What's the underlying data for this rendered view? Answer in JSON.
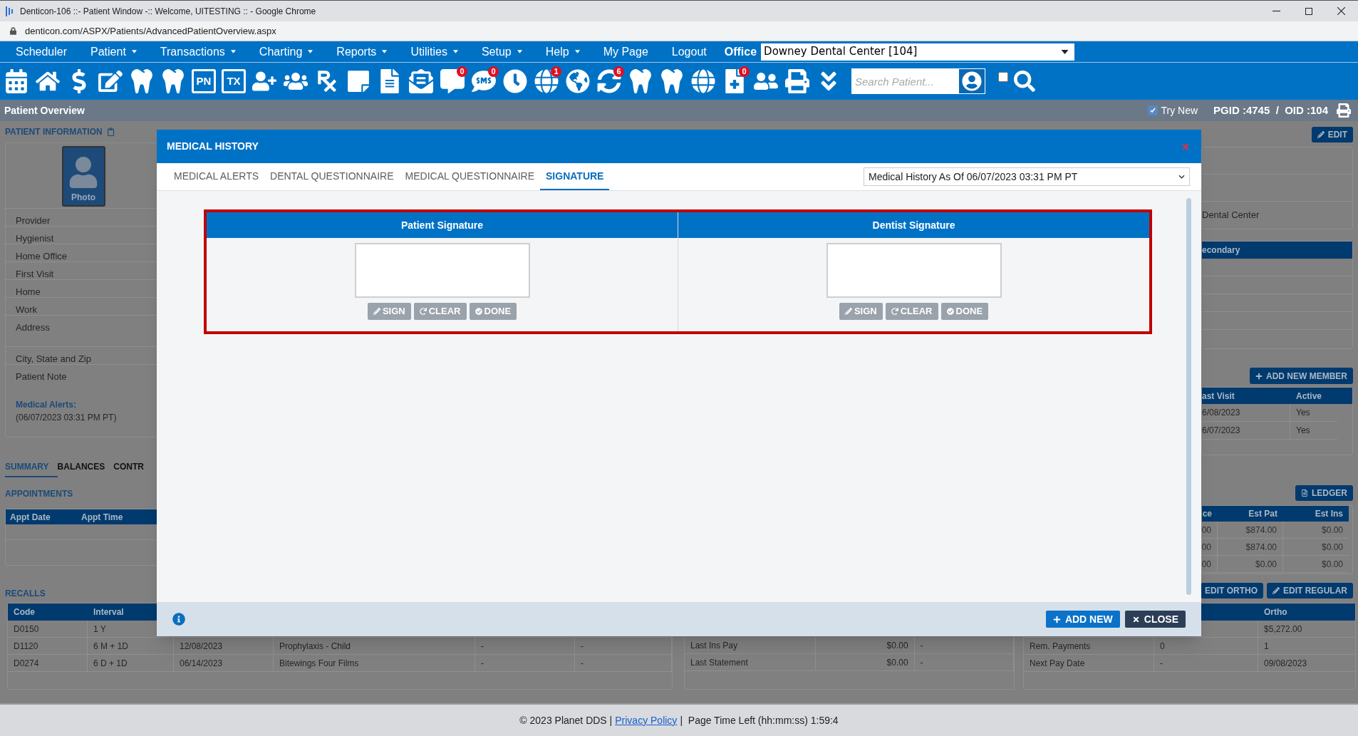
{
  "browser": {
    "title": "Denticon-106 ::- Patient Window -:: Welcome, UITESTING :: - Google Chrome",
    "url": "denticon.com/ASPX/Patients/AdvancedPatientOverview.aspx"
  },
  "menu": [
    {
      "label": "Scheduler",
      "dropdown": false
    },
    {
      "label": "Patient",
      "dropdown": true
    },
    {
      "label": "Transactions",
      "dropdown": true
    },
    {
      "label": "Charting",
      "dropdown": true
    },
    {
      "label": "Reports",
      "dropdown": true
    },
    {
      "label": "Utilities",
      "dropdown": true
    },
    {
      "label": "Setup",
      "dropdown": true
    },
    {
      "label": "Help",
      "dropdown": true
    },
    {
      "label": "My Page",
      "dropdown": false
    },
    {
      "label": "Logout",
      "dropdown": false
    }
  ],
  "office": {
    "label": "Office",
    "value": "Downey Dental Center [104]"
  },
  "toolbar": [
    {
      "kind": "icon"
    },
    {
      "kind": "icon"
    },
    {
      "kind": "icon"
    },
    {
      "kind": "icon"
    },
    {
      "kind": "icon"
    },
    {
      "kind": "icon"
    },
    {
      "kind": "text",
      "label": "PN"
    },
    {
      "kind": "text",
      "label": "TX"
    },
    {
      "kind": "icon"
    },
    {
      "kind": "icon"
    },
    {
      "kind": "icon"
    },
    {
      "kind": "icon"
    },
    {
      "kind": "icon"
    },
    {
      "kind": "icon"
    },
    {
      "kind": "icon",
      "badge": "0"
    },
    {
      "kind": "icon",
      "badge": "0"
    },
    {
      "kind": "icon"
    },
    {
      "kind": "icon",
      "badge": "1"
    },
    {
      "kind": "icon"
    },
    {
      "kind": "icon",
      "badge": "6"
    },
    {
      "kind": "icon"
    },
    {
      "kind": "icon"
    },
    {
      "kind": "icon"
    },
    {
      "kind": "icon",
      "badge": "0"
    },
    {
      "kind": "icon"
    },
    {
      "kind": "icon"
    },
    {
      "kind": "icon"
    }
  ],
  "search": {
    "placeholder": "Search Patient..."
  },
  "search_checkbox": {
    "checked": false
  },
  "overview": {
    "title": "Patient Overview",
    "try_new": {
      "label": "Try New",
      "checked": true
    },
    "ids": "PGID :4745  /  OID :104"
  },
  "patient_info": {
    "title": "PATIENT INFORMATION",
    "photo_label": "Photo",
    "fields": [
      "Provider",
      "Hygienist",
      "Home Office",
      "First Visit",
      "Home",
      "Work",
      "Address",
      "City, State and Zip",
      "Patient Note"
    ],
    "alerts_label": "Medical Alerts:",
    "alerts_date": "(06/07/2023 03:31 PM PT)"
  },
  "summary_tabs": [
    {
      "label": "SUMMARY",
      "selected": true
    },
    {
      "label": "BALANCES",
      "selected": false
    },
    {
      "label": "CONTR",
      "selected": false
    }
  ],
  "appointments": {
    "title": "APPOINTMENTS",
    "columns": [
      "Appt Date",
      "Appt Time"
    ]
  },
  "recalls": {
    "title": "RECALLS",
    "columns": [
      "Code",
      "Interval"
    ],
    "rows": [
      {
        "code": "D0150",
        "interval": "1 Y"
      },
      {
        "code": "D1120",
        "interval": "6 M + 1D",
        "column_3": "12/08/2023",
        "column_4": "Prophylaxis - Child",
        "column_5": "-",
        "column_6": "-"
      },
      {
        "code": "D0274",
        "interval": "6 D + 1D",
        "column_3": "06/14/2023",
        "column_4": "Bitewings Four Films",
        "column_5": "-",
        "column_6": "-"
      }
    ]
  },
  "right_panel": {
    "edit": "EDIT",
    "office_cell": "Dental Center",
    "insurance_header": "econdary",
    "add_member": "ADD NEW MEMBER",
    "family_columns": [
      "ast Visit",
      "Active"
    ],
    "family_rows": [
      [
        "6/08/2023",
        "Yes"
      ],
      [
        "6/07/2023",
        "Yes"
      ]
    ],
    "ledger": "LEDGER",
    "balance_columns": [
      "ce",
      "Est Pat",
      "Est Ins"
    ],
    "balance_rows": [
      [
        "00",
        "$874.00",
        "$0.00"
      ],
      [
        "00",
        "$874.00",
        "$0.00"
      ],
      [
        "00",
        "$0.00",
        "$0.00"
      ]
    ],
    "edit_ortho": "EDIT ORTHO",
    "edit_regular": "EDIT REGULAR"
  },
  "account": {
    "rows": [
      {
        "label": "Last Ins Pay",
        "value": "$0.00",
        "column_3": "-"
      },
      {
        "label": "Last Statement",
        "value": "$0.00",
        "column_3": "-"
      }
    ]
  },
  "payments": {
    "column": "Ortho",
    "rows": [
      {
        "ortho": "$5,272.00"
      },
      {
        "label": "Rem. Payments",
        "regular": "0",
        "ortho": "1"
      },
      {
        "label": "Next Pay Date",
        "regular": "-",
        "ortho": "09/08/2023"
      }
    ]
  },
  "modal": {
    "title": "MEDICAL HISTORY",
    "tabs": [
      {
        "label": "MEDICAL ALERTS",
        "selected": false
      },
      {
        "label": "DENTAL QUESTIONNAIRE",
        "selected": false
      },
      {
        "label": "MEDICAL QUESTIONNAIRE",
        "selected": false
      },
      {
        "label": "SIGNATURE",
        "selected": true
      }
    ],
    "history_select": "Medical History As Of 06/07/2023 03:31 PM PT",
    "signatures": [
      {
        "title": "Patient Signature",
        "buttons": [
          {
            "label": "SIGN",
            "kind": "sign",
            "disabled": true
          },
          {
            "label": "CLEAR",
            "kind": "clear",
            "disabled": true
          },
          {
            "label": "DONE",
            "kind": "done",
            "disabled": true
          }
        ]
      },
      {
        "title": "Dentist Signature",
        "buttons": [
          {
            "label": "SIGN",
            "kind": "sign",
            "disabled": true
          },
          {
            "label": "CLEAR",
            "kind": "clear",
            "disabled": true
          },
          {
            "label": "DONE",
            "kind": "done",
            "disabled": true
          }
        ]
      }
    ],
    "footer_buttons": [
      {
        "label": "ADD NEW",
        "kind": "add"
      },
      {
        "label": "CLOSE",
        "kind": "close"
      }
    ]
  },
  "footer": {
    "copyright": "© 2023 Planet DDS |",
    "link": "Privacy Policy",
    "time": "|  Page Time Left (hh:mm:ss) 1:59:4"
  }
}
